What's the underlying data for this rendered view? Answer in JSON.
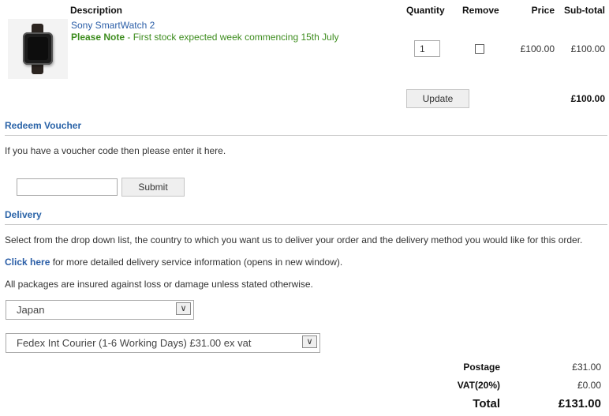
{
  "table": {
    "headers": {
      "description": "Description",
      "quantity": "Quantity",
      "remove": "Remove",
      "price": "Price",
      "subtotal": "Sub-total"
    },
    "item": {
      "name": "Sony SmartWatch 2",
      "note_label": "Please Note",
      "note_text": " - First stock expected week commencing 15th July",
      "quantity": "1",
      "remove_checked": false,
      "price": "£100.00",
      "subtotal": "£100.00"
    },
    "update_label": "Update",
    "total": "£100.00"
  },
  "voucher": {
    "title": "Redeem Voucher",
    "instructions": "If you have a voucher code then please enter it here.",
    "code_value": "",
    "submit_label": "Submit"
  },
  "delivery": {
    "title": "Delivery",
    "text1": "Select from the drop down list, the country to which you want us to deliver your order and the delivery method you would like for this order.",
    "click_here": "Click here",
    "text2_rest": " for more detailed delivery service information (opens in new window).",
    "text3": "All packages are insured against loss or damage unless stated otherwise.",
    "country_selected": "Japan",
    "method_selected": "Fedex Int Courier (1-6 Working Days) £31.00 ex vat",
    "arrow_glyph": "∨"
  },
  "summary": {
    "postage_label": "Postage",
    "postage_value": "£31.00",
    "vat_label": "VAT(20%)",
    "vat_value": "£0.00",
    "total_label": "Total",
    "total_value": "£131.00"
  },
  "colors": {
    "link": "#2b5ea7",
    "note": "#3d8c1e",
    "section_title": "#2b64a8"
  }
}
